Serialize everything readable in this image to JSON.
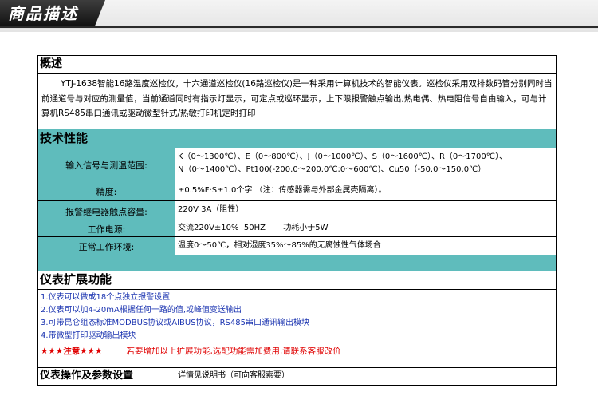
{
  "banner": {
    "title": "商品描述"
  },
  "overview": {
    "header": "概述",
    "text": "YTJ-1638智能16路温度巡检仪，十六通道巡检仪(16路巡检仪)是一种采用计算机技术的智能仪表。巡检仪采用双排数码管分别同时当前通道号与对应的测量值，当前通道同时有指示灯显示，可定点或巡环显示，上下限报警触点输出,热电偶、热电阻信号自由输入，可与计算机RS485串口通讯或驱动微型针式/热敏打印机定时打印"
  },
  "tech": {
    "header": "技术性能",
    "rows": [
      {
        "label": "输入信号与测温范围:",
        "lines": [
          "K（0～1300℃）、E（0～800℃）、J（0～1000℃）、S（0～1600℃）、R（0～1700℃）、",
          "N（0～1400℃）、Pt100(-200.0～200.0℃;0～600℃)、Cu50（-50.0～150.0℃）"
        ]
      },
      {
        "label": "精度:",
        "lines": [
          "±0.5%F·S±1.0个字 （注：传感器需与外部金属壳隔离）。"
        ]
      },
      {
        "label": "报警继电器触点容量:",
        "lines": [
          "220V 3A（阻性）"
        ]
      },
      {
        "label": "工作电源:",
        "lines": [
          "交流220V±10%  50HZ       功耗小于5W"
        ]
      },
      {
        "label": "正常工作环境:",
        "lines": [
          "温度0～50℃，相对湿度35%～85%的无腐蚀性气体场合"
        ]
      }
    ]
  },
  "extension": {
    "header": "仪表扩展功能",
    "items": [
      "1.仪表可以做成18个点独立报警设置",
      "2.仪表可以加4-20mA根据任何一路的值,或峰值变送输出",
      "3.可带昆仑组态标准MODBUS协议或AIBUS协议，RS485串口通讯输出模块",
      "4.带微型打印驱动输出模块"
    ],
    "note_stars": "★★★注意★★★",
    "note_text": "若要增加以上扩展功能,选配功能需加费用,请联系客服改价"
  },
  "operation": {
    "header": "仪表操作及参数设置",
    "value": "详情见说明书（可向客服索要）"
  }
}
